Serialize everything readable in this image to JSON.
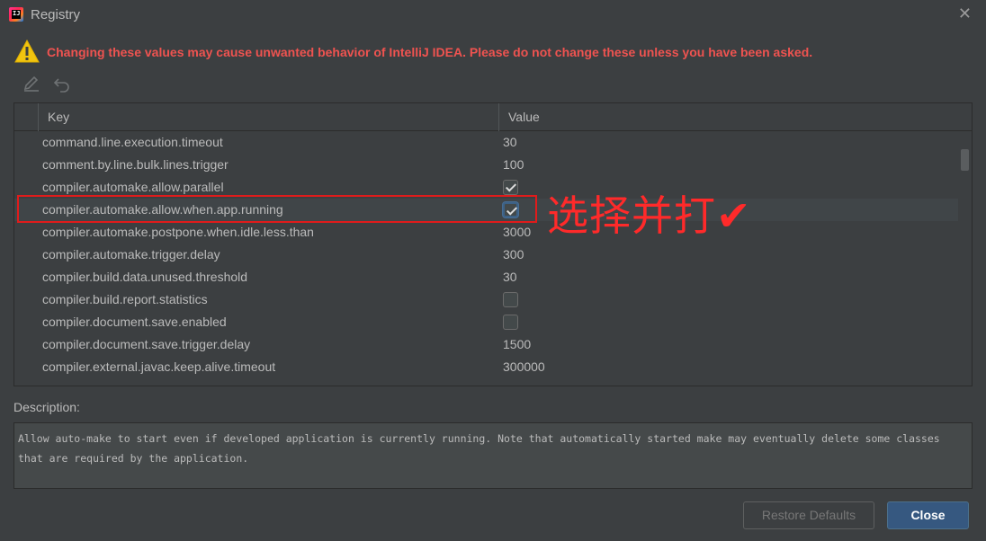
{
  "window": {
    "title": "Registry",
    "app_icon_text": "IJ"
  },
  "warning": {
    "text": "Changing these values may cause unwanted behavior of IntelliJ IDEA. Please do not change these unless you have been asked.",
    "color": "#ef5350"
  },
  "toolbar": {
    "edit_icon": "edit-pencil-icon",
    "revert_icon": "undo-icon"
  },
  "table": {
    "columns": {
      "key": "Key",
      "value": "Value"
    },
    "rows": [
      {
        "key": "command.line.execution.timeout",
        "value": "30"
      },
      {
        "key": "comment.by.line.bulk.lines.trigger",
        "value": "100"
      },
      {
        "key": "compiler.automake.allow.parallel",
        "checked": true
      },
      {
        "key": "compiler.automake.allow.when.app.running",
        "checked": true
      },
      {
        "key": "compiler.automake.postpone.when.idle.less.than",
        "value": "3000"
      },
      {
        "key": "compiler.automake.trigger.delay",
        "value": "300"
      },
      {
        "key": "compiler.build.data.unused.threshold",
        "value": "30"
      },
      {
        "key": "compiler.build.report.statistics",
        "checked": false
      },
      {
        "key": "compiler.document.save.enabled",
        "checked": false
      },
      {
        "key": "compiler.document.save.trigger.delay",
        "value": "1500"
      },
      {
        "key": "compiler.external.javac.keep.alive.timeout",
        "value": "300000"
      }
    ]
  },
  "annotation": {
    "text": "选择并打✔",
    "color": "#ff2a2a"
  },
  "description": {
    "label": "Description:",
    "text": "Allow auto-make to start even if developed application is currently running. Note that automatically started make may eventually delete some classes that are required by the application."
  },
  "buttons": {
    "restore": "Restore Defaults",
    "close": "Close"
  }
}
